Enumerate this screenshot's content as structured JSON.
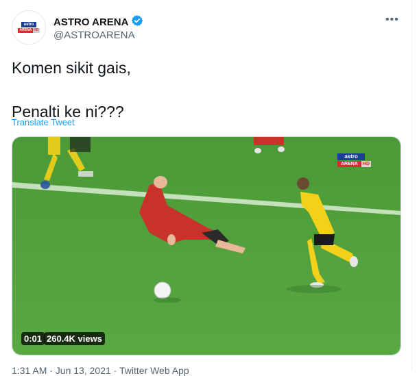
{
  "author": {
    "name": "ASTRO ARENA",
    "handle": "@ASTROARENA",
    "avatar_top": "astro",
    "avatar_bottom_left": "ARENA",
    "avatar_bottom_right": "HD"
  },
  "tweet": {
    "line1": "Komen sikit gais,",
    "line2": "Penalti ke ni???",
    "translate_label": "Translate Tweet"
  },
  "video": {
    "time": "0:01",
    "views": "260.4K views",
    "overlay_logo_top": "astro",
    "overlay_logo_left": "ARENA",
    "overlay_logo_right": "HD"
  },
  "footer": {
    "meta": "1:31 AM · Jun 13, 2021 · Twitter Web App"
  },
  "colors": {
    "link": "#1d9bf0",
    "verified": "#1d9bf0",
    "pitch": "#4f9e3a",
    "malaysia_kit": "#f3d11a",
    "vietnam_kit": "#c8322a"
  }
}
